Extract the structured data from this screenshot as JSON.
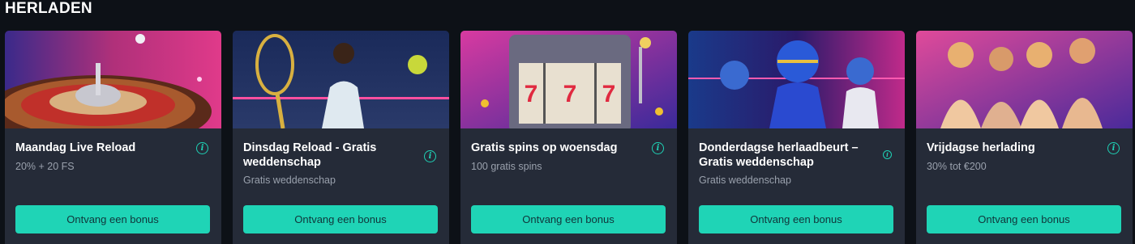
{
  "section": {
    "title": "HERLADEN"
  },
  "cards": [
    {
      "title": "Maandag Live Reload",
      "subtitle": "20% + 20 FS",
      "button": "Ontvang een bonus",
      "image": "roulette-wheel",
      "info_icon": "info-icon"
    },
    {
      "title": "Dinsdag Reload - Gratis weddenschap",
      "subtitle": "Gratis weddenschap",
      "button": "Ontvang een bonus",
      "image": "tennis-player",
      "info_icon": "info-icon"
    },
    {
      "title": "Gratis spins op woensdag",
      "subtitle": "100 gratis spins",
      "button": "Ontvang een bonus",
      "image": "slot-machine",
      "info_icon": "info-icon"
    },
    {
      "title": "Donderdagse herlaadbeurt – Gratis weddenschap",
      "subtitle": "Gratis weddenschap",
      "button": "Ontvang een bonus",
      "image": "football-players",
      "info_icon": "info-icon"
    },
    {
      "title": "Vrijdagse herlading",
      "subtitle": "30% tot €200",
      "button": "Ontvang een bonus",
      "image": "party-women",
      "info_icon": "info-icon"
    }
  ],
  "colors": {
    "background": "#0d1117",
    "card": "#252b38",
    "accent": "#1fd4b6",
    "subtext": "#9aa1ad"
  }
}
